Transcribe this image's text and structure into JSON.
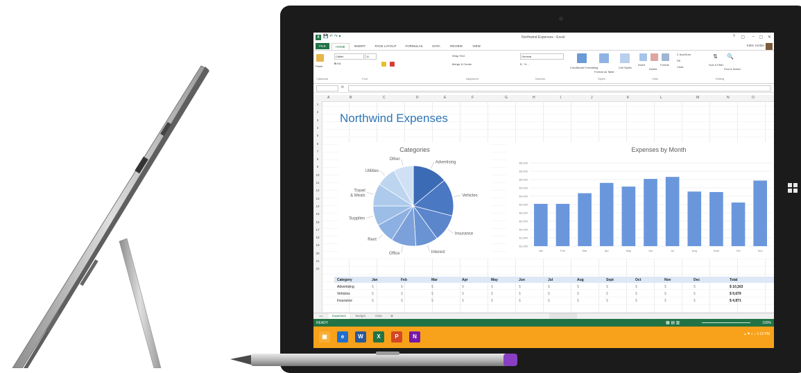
{
  "excel": {
    "title_bar": "Northwind Expenses - Excel",
    "window_controls": [
      "?",
      "▢",
      "–",
      "▢",
      "✕"
    ],
    "user_name": "Katie Jordan",
    "ribbon_tabs": [
      "FILE",
      "HOME",
      "INSERT",
      "PAGE LAYOUT",
      "FORMULAS",
      "DATA",
      "REVIEW",
      "VIEW"
    ],
    "ribbon": {
      "font_name": "Calibri",
      "font_size": "11",
      "wrap_text": "Wrap Text",
      "merge_center": "Merge & Center",
      "number_format": "General",
      "conditional_formatting": "Conditional Formatting",
      "format_as_table": "Format as Table",
      "cell_styles": "Cell Styles",
      "insert": "Insert",
      "delete": "Delete",
      "format": "Format",
      "autosum": "AutoSum",
      "fill": "Fill",
      "clear": "Clear",
      "sort_filter": "Sort & Filter",
      "find_select": "Find & Select",
      "groups": [
        "Clipboard",
        "Font",
        "Alignment",
        "Number",
        "Styles",
        "Cells",
        "Editing"
      ],
      "paste": "Paste"
    },
    "columns": [
      "A",
      "B",
      "C",
      "D",
      "E",
      "F",
      "G",
      "H",
      "I",
      "J",
      "K",
      "L",
      "M",
      "N",
      "O"
    ],
    "rows": [
      "1",
      "2",
      "3",
      "4",
      "5",
      "6",
      "7",
      "8",
      "9",
      "10",
      "11",
      "12",
      "13",
      "14",
      "15",
      "16",
      "17",
      "18",
      "19",
      "20",
      "21",
      "22"
    ],
    "sheet_title": "Northwind Expenses",
    "table": {
      "headers": [
        "Category",
        "Jan",
        "Feb",
        "Mar",
        "Apr",
        "May",
        "Jun",
        "Jul",
        "Aug",
        "Sept",
        "Oct",
        "Nov",
        "Dec",
        "Total"
      ],
      "rows": [
        {
          "category": "Advertising",
          "total": "10,163"
        },
        {
          "category": "Vehicles",
          "total": "9,679"
        },
        {
          "category": "Insurance",
          "total": "4,871"
        }
      ]
    },
    "sheet_tabs": [
      "Expenses",
      "Budget",
      "Data"
    ],
    "status": "READY",
    "zoom": "100%"
  },
  "chart_data": [
    {
      "type": "pie",
      "title": "Categories",
      "labels": [
        "Advertising",
        "Vehicles",
        "Insurance",
        "Interest",
        "Office",
        "Rent",
        "Supplies",
        "Travel & Meals",
        "Utilities",
        "Other"
      ],
      "values": [
        14,
        15,
        11,
        9,
        10,
        8,
        8,
        9,
        8,
        8
      ],
      "colors": [
        "#3c6bb6",
        "#4a78c2",
        "#5b86cc",
        "#6a93d3",
        "#7ca1da",
        "#8cb0e1",
        "#9cbde6",
        "#adc9eb",
        "#bed5f0",
        "#d0e1f5"
      ]
    },
    {
      "type": "bar",
      "title": "Expenses by Month",
      "categories": [
        "Jan",
        "Feb",
        "Mar",
        "Apr",
        "May",
        "Jun",
        "Jul",
        "Aug",
        "Sept",
        "Oct",
        "Nov"
      ],
      "values": [
        3540,
        3540,
        4180,
        4800,
        4580,
        5040,
        5160,
        4280,
        4250,
        3620,
        4940
      ],
      "yticks": [
        "$1,000",
        "$1,500",
        "$2,000",
        "$2,500",
        "$3,000",
        "$3,500",
        "$4,000",
        "$4,500",
        "$5,000",
        "$5,500",
        "$6,000"
      ],
      "ylim": [
        1000,
        6000
      ],
      "color": "#6a97dc"
    }
  ],
  "taskbar": {
    "clock": "1:15 PM"
  }
}
